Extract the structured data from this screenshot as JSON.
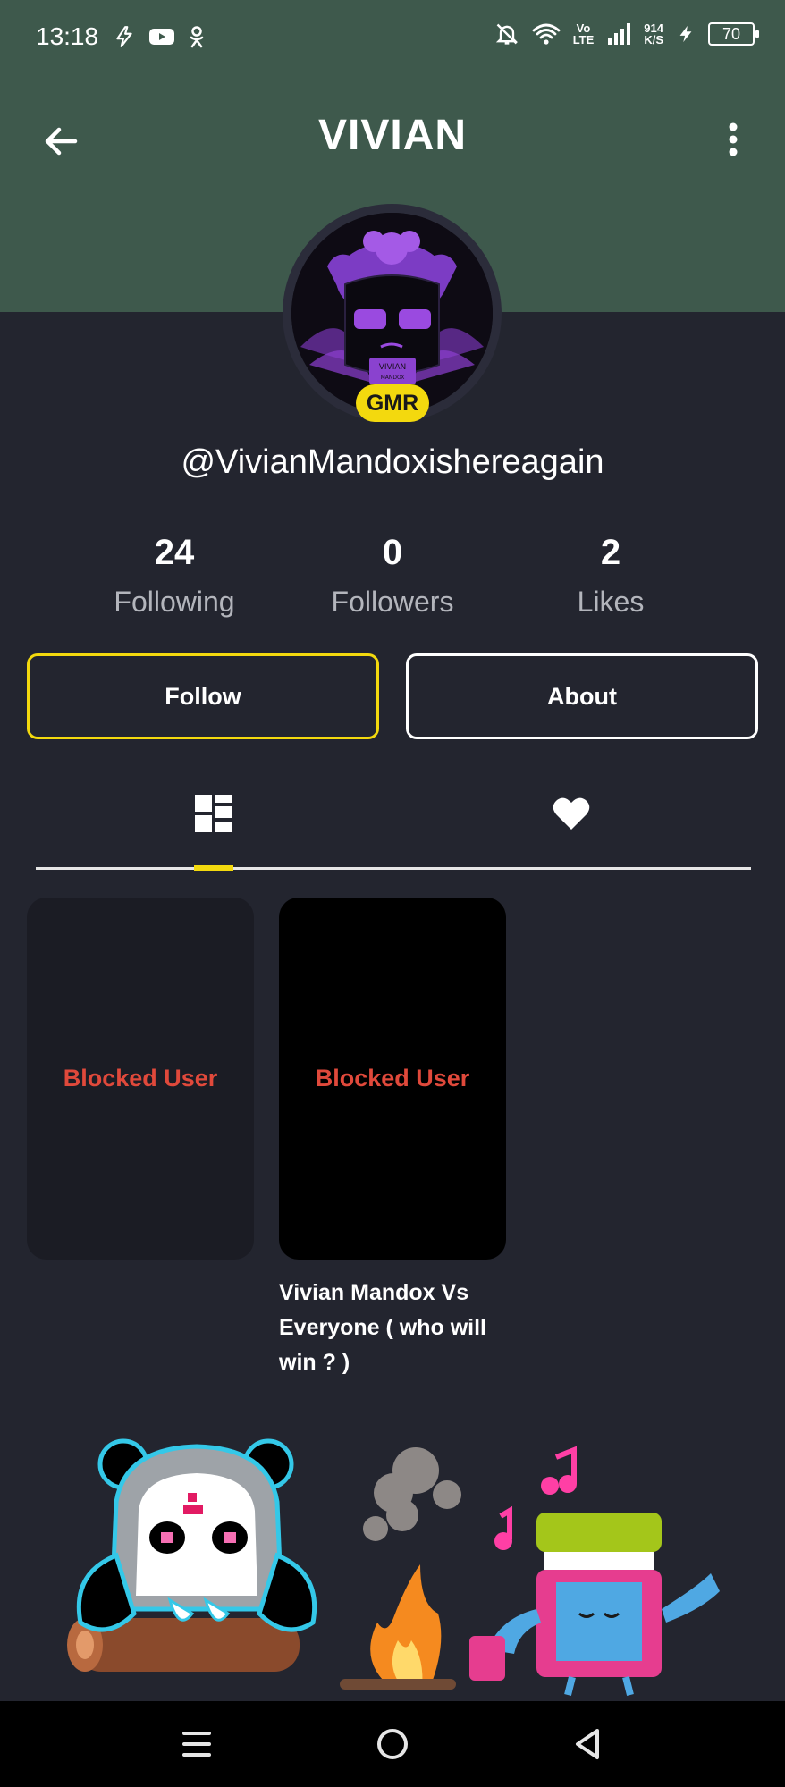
{
  "status_bar": {
    "time": "13:18",
    "volte": [
      "Vo",
      "LTE"
    ],
    "speed": [
      "914",
      "K/S"
    ],
    "battery": "70"
  },
  "header": {
    "title": "VIVIAN"
  },
  "profile": {
    "badge": "GMR",
    "avatar_text": [
      "VIVIAN",
      "MANDOX"
    ],
    "username": "@VivianMandoxishereagain"
  },
  "stats": [
    {
      "value": "24",
      "label": "Following"
    },
    {
      "value": "0",
      "label": "Followers"
    },
    {
      "value": "2",
      "label": "Likes"
    }
  ],
  "actions": {
    "follow": "Follow",
    "about": "About"
  },
  "tabs": {
    "active": "posts"
  },
  "posts": [
    {
      "overlay": "Blocked User",
      "caption": ""
    },
    {
      "overlay": "Blocked User",
      "caption": "Vivian Mandox Vs Everyone ( who will win ? )"
    }
  ],
  "colors": {
    "header_bg": "#3e594c",
    "body_bg": "#23252f",
    "accent": "#f3d90e",
    "blocked_text": "#e0493b"
  }
}
